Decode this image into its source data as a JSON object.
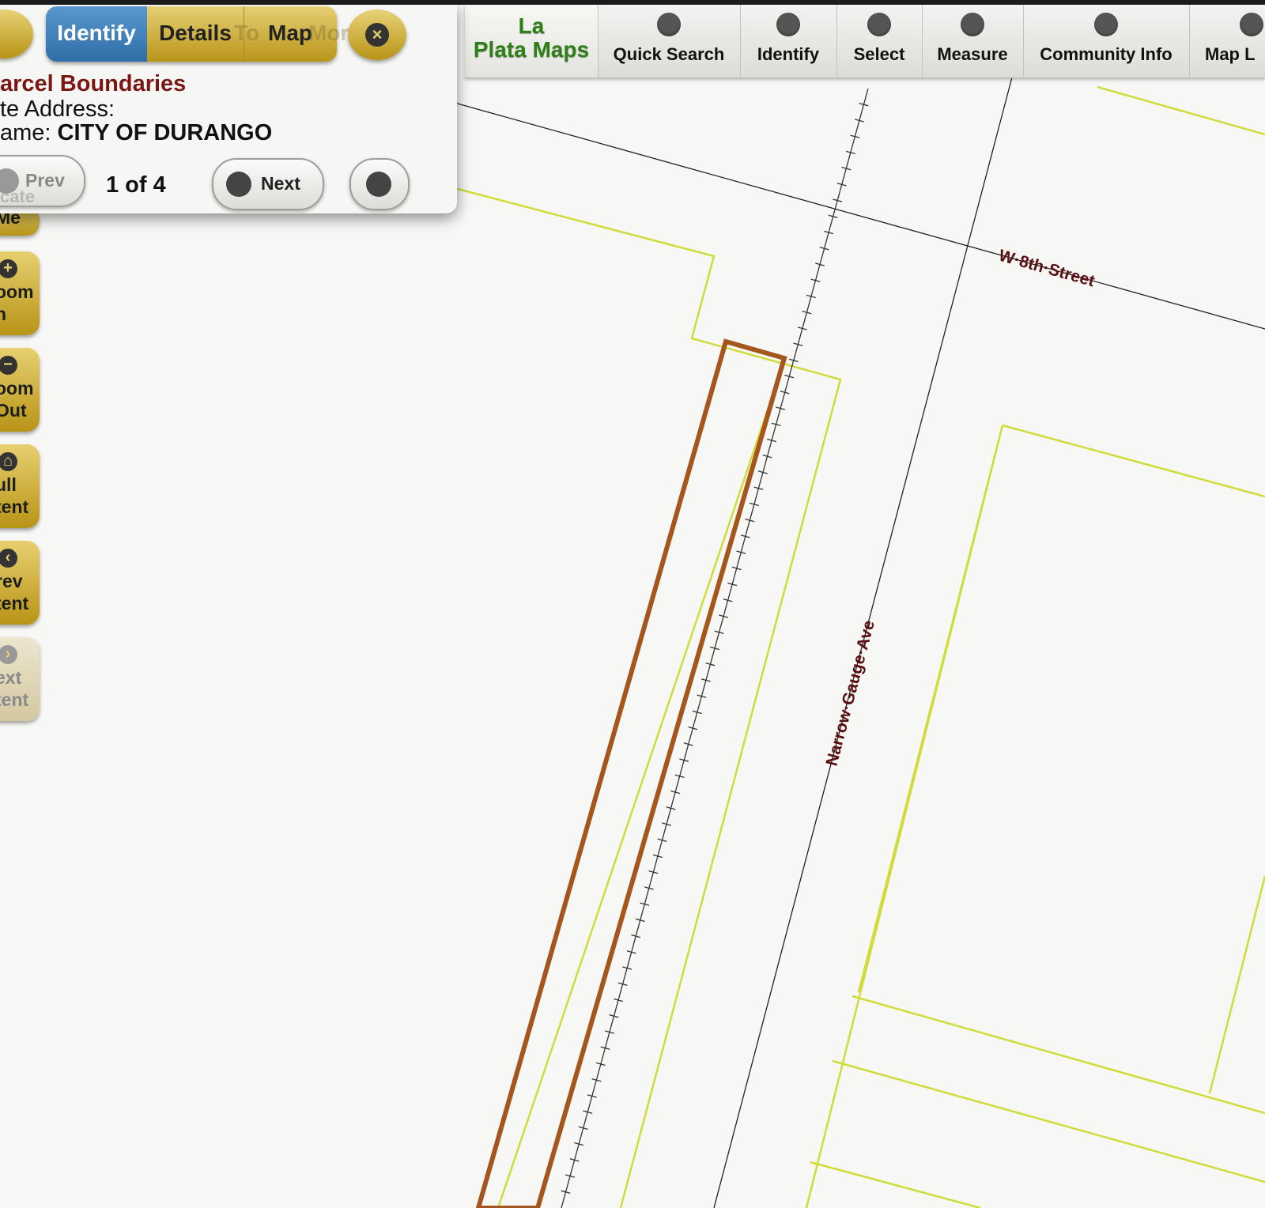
{
  "toolbar": {
    "brand_line1": "La",
    "brand_line2": "Plata Maps",
    "buttons": [
      {
        "label": "Quick Search",
        "icon": "search-icon"
      },
      {
        "label": "Identify",
        "icon": "info-icon"
      },
      {
        "label": "Select",
        "icon": "home-icon"
      },
      {
        "label": "Measure",
        "icon": "home-icon"
      },
      {
        "label": "Community Info",
        "icon": "star-icon"
      },
      {
        "label": "Map L",
        "icon": "list-icon"
      }
    ]
  },
  "popup": {
    "tabs": [
      "Identify",
      "Details",
      "Map"
    ],
    "active_tab": "Identify",
    "ghost_text_1": "To",
    "ghost_text_2": "More",
    "layer_title": "arcel Boundaries",
    "address_label": "te Address:",
    "name_label": "ame:",
    "name_value": "CITY OF DURANGO",
    "prev_label": "Prev",
    "next_label": "Next",
    "counter": "1 of 4",
    "ghost_locate": "cate"
  },
  "side_buttons": [
    {
      "line1": "Me",
      "line2": ""
    },
    {
      "line1": "oom",
      "line2": "n",
      "icon": "plus-icon"
    },
    {
      "line1": "oom",
      "line2": "Out",
      "icon": "minus-icon"
    },
    {
      "line1": "ull",
      "line2": "tent",
      "icon": "home-icon"
    },
    {
      "line1": "rev",
      "line2": "tent",
      "icon": "back-icon"
    },
    {
      "line1": "ext",
      "line2": "tent",
      "icon": "forward-icon",
      "disabled": true
    }
  ],
  "map": {
    "street_1": "W·8th·Street",
    "street_2": "Narrow·Gauge·Ave",
    "colors": {
      "background": "#f7f7f6",
      "parcel_line": "#cfdc3a",
      "selected_parcel": "#a4561c",
      "street_label": "#5a1010",
      "gold": "#c9a83a",
      "active_tab": "#3c7fbc",
      "brand_green": "#2f7f18"
    }
  }
}
